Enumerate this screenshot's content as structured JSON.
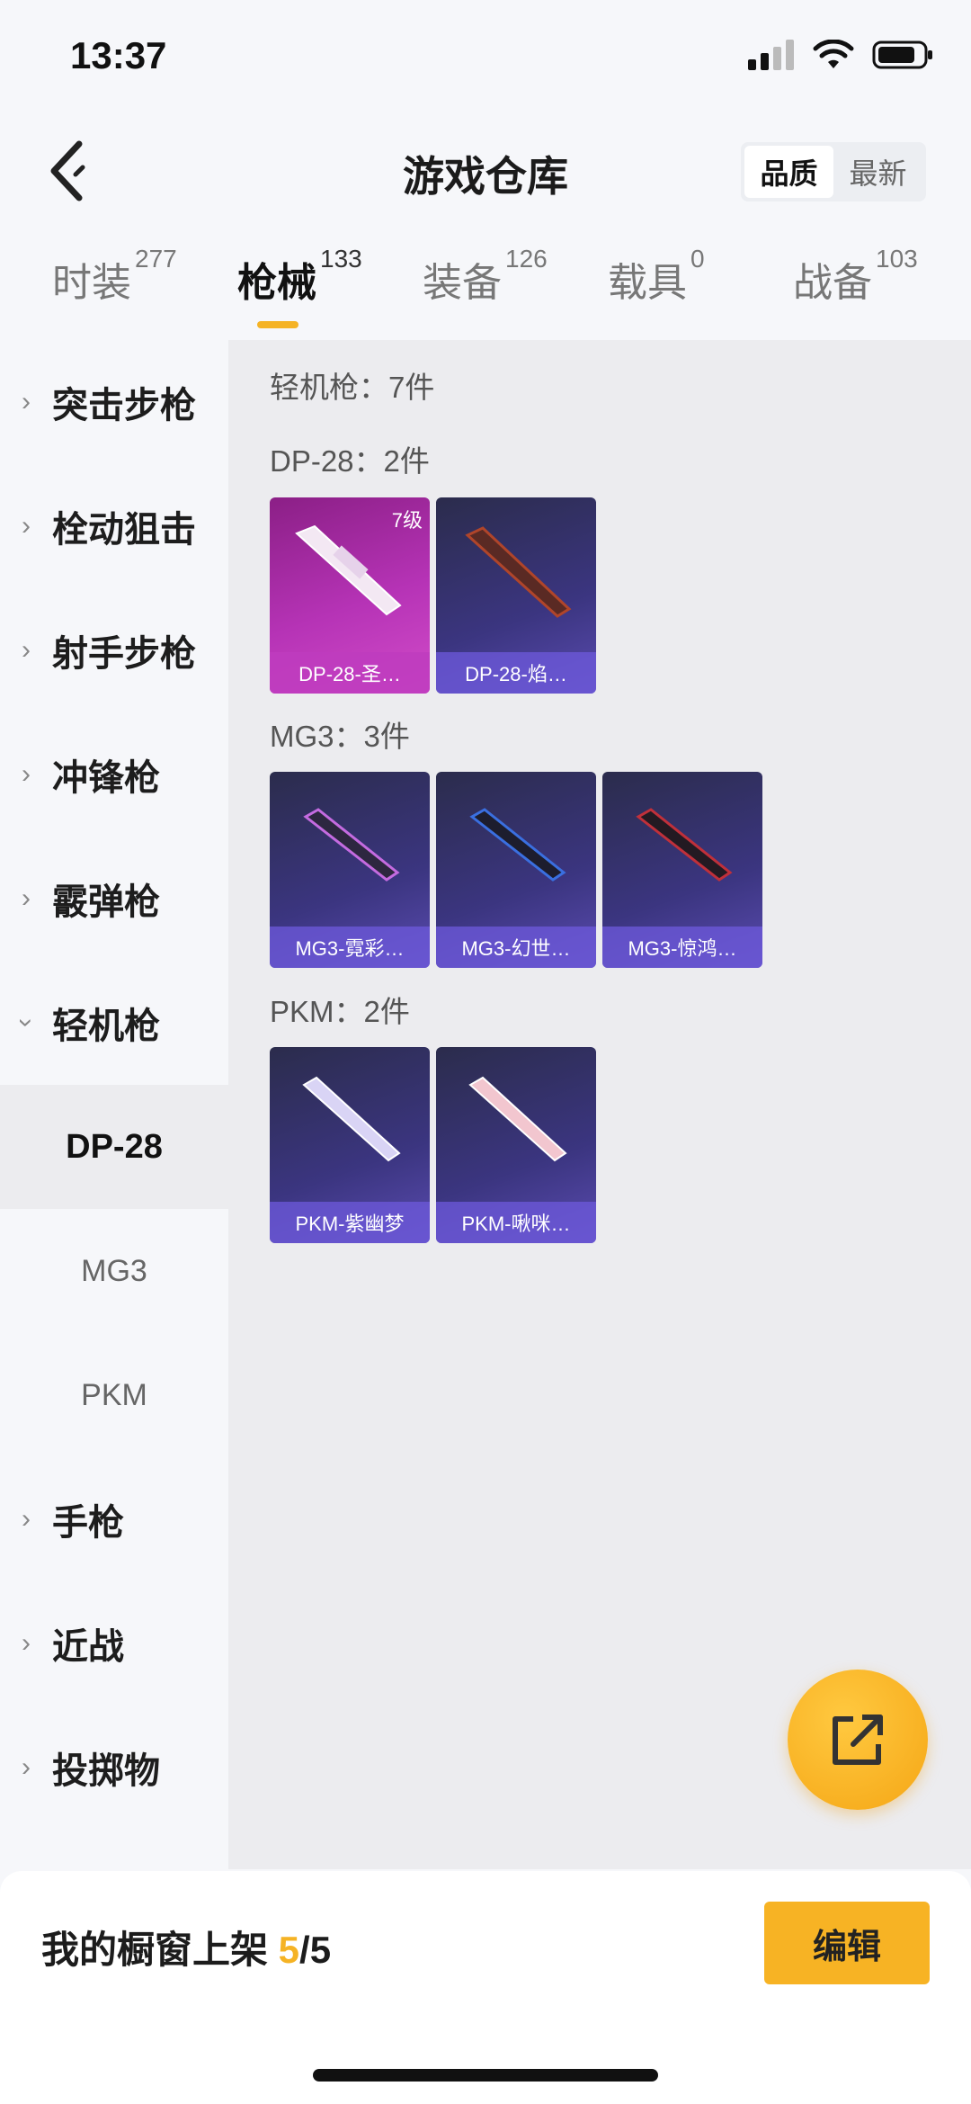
{
  "status": {
    "time": "13:37"
  },
  "header": {
    "title": "游戏仓库",
    "sort_options": [
      "品质",
      "最新"
    ],
    "sort_active": "品质"
  },
  "tabs": [
    {
      "label": "时装",
      "count": "277"
    },
    {
      "label": "枪械",
      "count": "133"
    },
    {
      "label": "装备",
      "count": "126"
    },
    {
      "label": "载具",
      "count": "0"
    },
    {
      "label": "战备",
      "count": "103"
    }
  ],
  "sidebar": {
    "categories": [
      "突击步枪",
      "栓动狙击",
      "射手步枪",
      "冲锋枪",
      "霰弹枪",
      "轻机枪"
    ],
    "sub_items": [
      "DP-28",
      "MG3",
      "PKM"
    ],
    "more_categories": [
      "手枪",
      "近战",
      "投掷物"
    ]
  },
  "content": {
    "section_title": "轻机枪：7件",
    "groups": [
      {
        "title": "DP-28：2件",
        "items": [
          {
            "name": "DP-28-圣…",
            "level": "7级",
            "style": "pink",
            "accent": "#ffffff"
          },
          {
            "name": "DP-28-焰…",
            "style": "purple",
            "accent": "#b0452a"
          }
        ]
      },
      {
        "title": "MG3：3件",
        "items": [
          {
            "name": "MG3-霓彩…",
            "style": "purple",
            "accent": "#c46be0"
          },
          {
            "name": "MG3-幻世…",
            "style": "purple",
            "accent": "#3a6fe0"
          },
          {
            "name": "MG3-惊鸿…",
            "style": "purple",
            "accent": "#c0303a"
          }
        ]
      },
      {
        "title": "PKM：2件",
        "items": [
          {
            "name": "PKM-紫幽梦",
            "style": "purple",
            "accent": "#d9d4f5"
          },
          {
            "name": "PKM-啾咪…",
            "style": "purple",
            "accent": "#f2c6cf"
          }
        ]
      }
    ]
  },
  "bottom": {
    "shelf_label": "我的橱窗上架 ",
    "shelf_count": "5",
    "shelf_total": "/5",
    "edit_label": "编辑"
  },
  "colors": {
    "accent": "#f5b325"
  }
}
